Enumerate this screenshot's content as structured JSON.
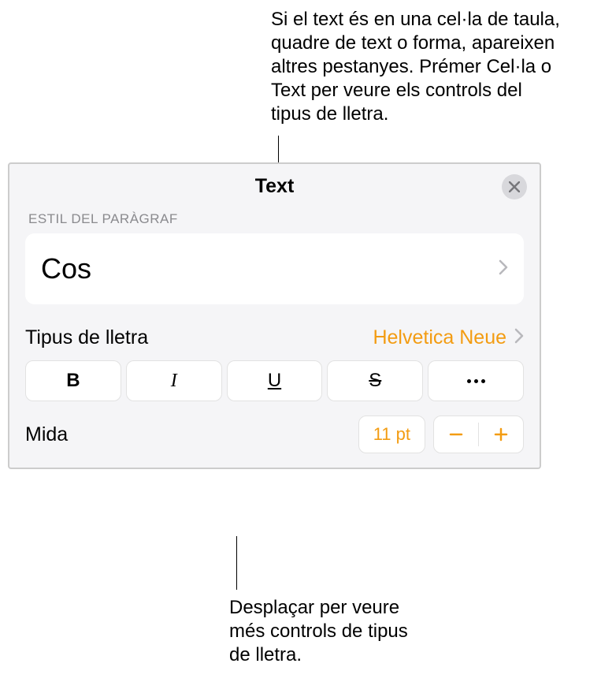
{
  "annotations": {
    "top": "Si el text és en una cel·la de taula, quadre de text o forma, apareixen altres pestanyes. Prémer Cel·la o Text per veure els controls del tipus de lletra.",
    "bottom": "Desplaçar per veure més controls de tipus de lletra."
  },
  "panel": {
    "title": "Text",
    "paragraph_section_label": "ESTIL DEL PARÀGRAF",
    "paragraph_style_value": "Cos",
    "font_label": "Tipus de lletra",
    "font_value": "Helvetica Neue",
    "style_buttons": {
      "bold": "B",
      "italic": "I",
      "underline": "U",
      "strike": "S"
    },
    "size_label": "Mida",
    "size_value": "11 pt"
  }
}
